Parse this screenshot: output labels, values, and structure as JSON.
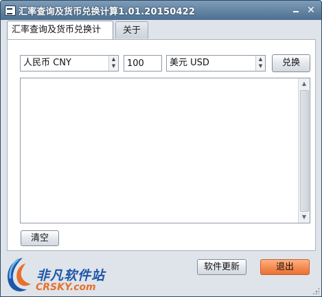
{
  "window": {
    "title": "汇率查询及货币兑换计算1.01.20150422"
  },
  "tabs": [
    {
      "label": "汇率查询及货币兑换计算",
      "active": true
    },
    {
      "label": "关于",
      "active": false
    }
  ],
  "converter": {
    "from_currency": "人民币 CNY",
    "amount": "100",
    "to_currency": "美元 USD",
    "convert_label": "兑换",
    "result_text": ""
  },
  "actions": {
    "clear_label": "清空",
    "update_label": "软件更新",
    "exit_label": "退出"
  },
  "logo": {
    "cn_text": "非凡软件站",
    "en_text": "CRSKY.com"
  },
  "colors": {
    "title_bar": "#5a7b9c",
    "exit_button": "#f58a4e",
    "logo_blue": "#1d56a8",
    "logo_orange": "#e8702a"
  }
}
